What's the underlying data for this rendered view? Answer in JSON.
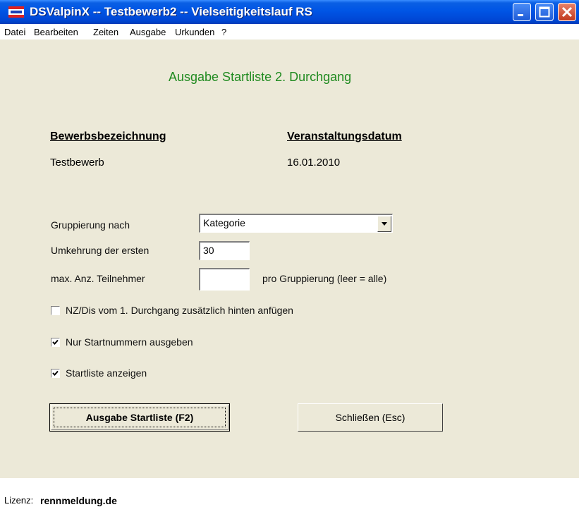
{
  "window": {
    "title": "DSValpinX -- Testbewerb2 -- Vielseitigkeitslauf RS",
    "colors": {
      "titlebar": "#0055E5",
      "client": "#ECE9D8",
      "accent_text": "#1F8A1F"
    }
  },
  "menu": {
    "items": [
      "Datei",
      "Bearbeiten",
      "Zeiten",
      "Ausgabe",
      "Urkunden",
      "?"
    ]
  },
  "form": {
    "title": "Ausgabe Startliste 2. Durchgang",
    "competition_heading": "Bewerbsbezeichnung",
    "competition_value": "Testbewerb",
    "date_heading": "Veranstaltungsdatum",
    "date_value": "16.01.2010",
    "grouping_label": "Gruppierung nach",
    "grouping_value": "Kategorie",
    "reverse_label": "Umkehrung der ersten",
    "reverse_value": "30",
    "max_label": "max. Anz. Teilnehmer",
    "max_value": "",
    "max_suffix": "pro Gruppierung (leer = alle)",
    "checkboxes": [
      {
        "label": "NZ/Dis vom 1. Durchgang zusätzlich hinten anfügen",
        "checked": false
      },
      {
        "label": "Nur Startnummern ausgeben",
        "checked": true
      },
      {
        "label": "Startliste anzeigen",
        "checked": true
      }
    ],
    "output_button": "Ausgabe Startliste (F2)",
    "close_button": "Schließen (Esc)"
  },
  "status": {
    "license_label": "Lizenz:",
    "license_value": "rennmeldung.de"
  }
}
